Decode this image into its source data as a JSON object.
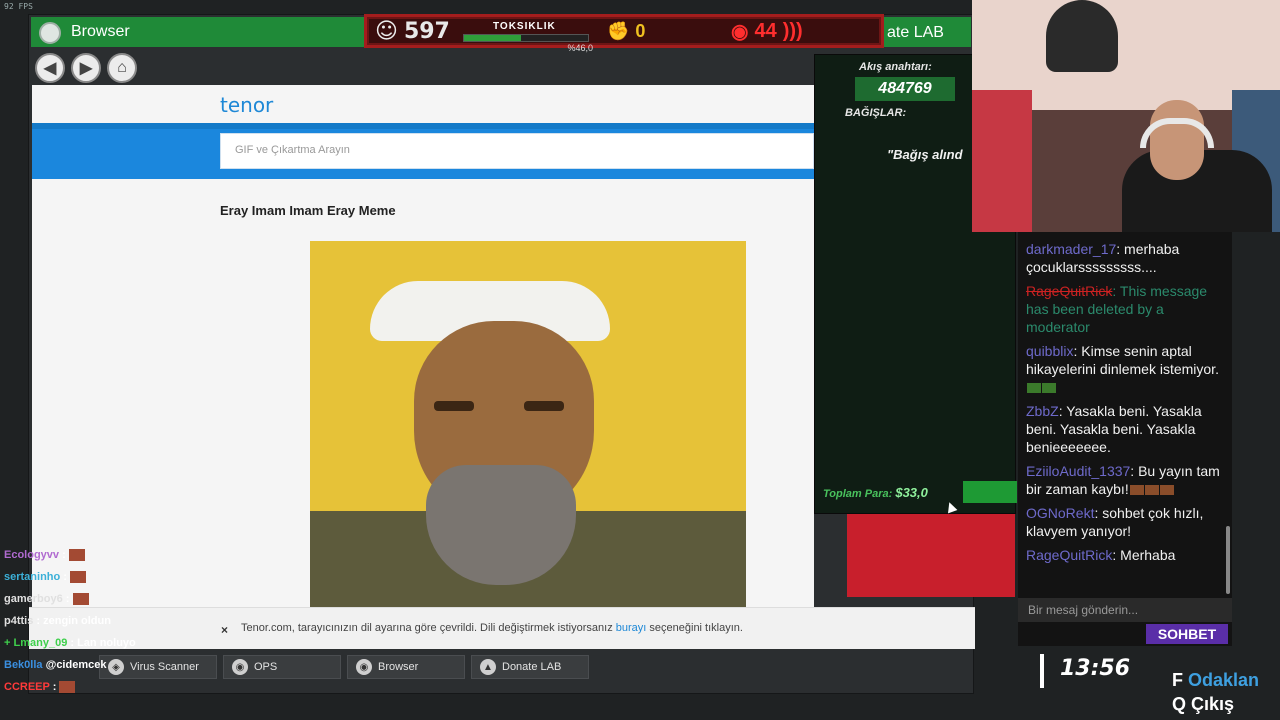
{
  "fps": "92 FPS",
  "window": {
    "title": "Browser",
    "title_right": "ate LAB"
  },
  "hud": {
    "viewers": "597",
    "toxicity_label": "TOKSIKLIK",
    "toxicity_pct": "%46,0",
    "toxicity_value": 46.0,
    "fist": "0",
    "views": "44"
  },
  "browser": {
    "logo": "tenor",
    "search_placeholder": "GIF ve Çıkartma Arayın",
    "heading": "Eray Imam Imam Eray Meme",
    "notice_text": "Tenor.com, tarayıcınızın dil ayarına göre çevrildi. Dili değiştirmek istiyorsanız",
    "notice_link": "burayı",
    "notice_tail": "seçeneğini tıklayın.",
    "notice_close": "×"
  },
  "taskbar": [
    {
      "label": "Virus Scanner",
      "icon": "shield-icon"
    },
    {
      "label": "OPS",
      "icon": "globe-icon"
    },
    {
      "label": "Browser",
      "icon": "browser-icon"
    },
    {
      "label": "Donate LAB",
      "icon": "flask-icon"
    }
  ],
  "donate": {
    "stream_key_label": "Akış anahtarı:",
    "stream_key": "484769",
    "donations_label": "BAĞIŞLAR:",
    "quote": "\"Bağış alınd",
    "total_label": "Toplam Para:",
    "total_value": "$33,0"
  },
  "chat": {
    "messages": [
      {
        "nick": "darkmader_17",
        "text": ": merhaba çocuklarsssssssss...."
      },
      {
        "nick": "RageQuitRick",
        "text": ": This message has been deleted by a moderator",
        "deleted": true
      },
      {
        "nick": "quibblix",
        "text": ": Kimse senin aptal hikayelerini dinlemek istemiyor."
      },
      {
        "nick": "ZbbZ",
        "text": ": Yasakla beni. Yasakla beni. Yasakla beni. Yasakla benieeeeeee."
      },
      {
        "nick": "EziiloAudit_1337",
        "text": ": Bu yayın tam bir zaman kaybı!"
      },
      {
        "nick": "OGNoRekt",
        "text": ": sohbet çok hızlı, klavyem yanıyor!"
      },
      {
        "nick": "RageQuitRick",
        "text": ": Merhaba"
      }
    ],
    "input_placeholder": "Bir mesaj gönderin...",
    "button": "SOHBET"
  },
  "left_chat": [
    {
      "nick": "Ecologyvv",
      "text": " :"
    },
    {
      "nick": "sertaninho",
      "text": " :"
    },
    {
      "nick": "gamerboy6",
      "text": " :"
    },
    {
      "nick": "p4ttis",
      "text": " : zengin oldun"
    },
    {
      "nick": "Lmany_09",
      "text": " : Lan noluyo"
    },
    {
      "nick": "Bek0lla",
      "text": " @cidemcek"
    },
    {
      "nick": "CCREEP",
      "text": " :"
    }
  ],
  "clock": "13:56",
  "keys": {
    "focus_key": "F",
    "focus_label": "Odaklan",
    "exit_key": "Q",
    "exit_label": "Çıkış"
  },
  "colors": {
    "accent_green": "#1f8a38",
    "tenor_blue": "#1b87dd",
    "chat_button": "#5a2ea8",
    "hud_red": "#a41d1d"
  }
}
